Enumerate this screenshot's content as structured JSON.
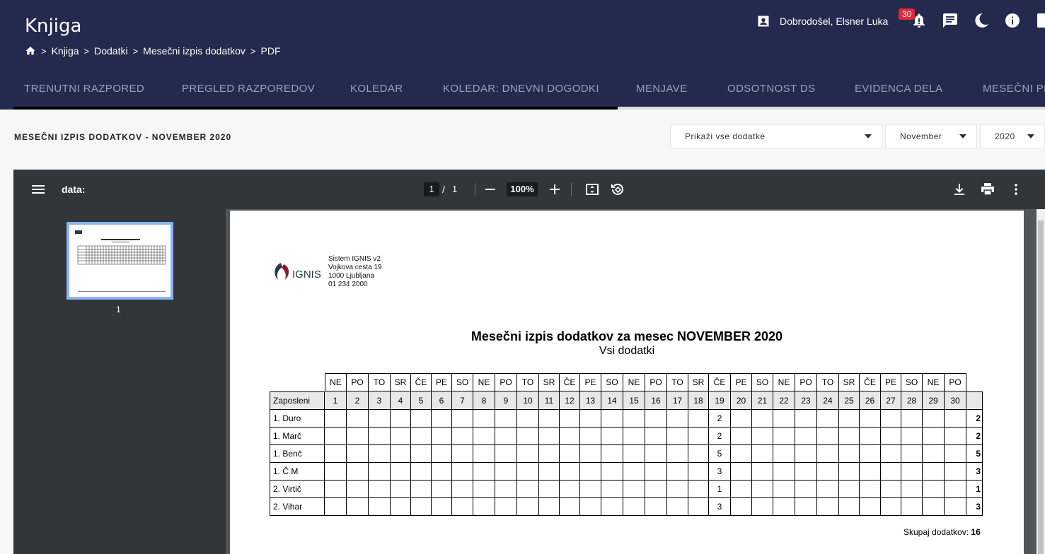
{
  "header": {
    "title": "Knjiga",
    "breadcrumb": [
      "Knjiga",
      "Dodatki",
      "Mesečni izpis dodatkov",
      "PDF"
    ],
    "user_greeting": "Dobrodošel, Elsner Luka",
    "notification_count": "30"
  },
  "tabs": [
    "TRENUTNI RAZPORED",
    "PREGLED RAZPOREDOV",
    "KOLEDAR",
    "KOLEDAR: DNEVNI DOGODKI",
    "MENJAVE",
    "ODSOTNOST DS",
    "EVIDENCA DELA",
    "MESEČNI PL"
  ],
  "page": {
    "heading": "MESEČNI IZPIS DODATKOV - NOVEMBER 2020",
    "filter_type": "Prikaži vse dodatke",
    "filter_month": "November",
    "filter_year": "2020"
  },
  "viewer": {
    "doc_name": "data:",
    "page_current": "1",
    "page_sep": "/",
    "page_total": "1",
    "zoom": "100%",
    "thumb_label": "1"
  },
  "report": {
    "company": [
      "Sistem IGNIS v2",
      "Vojkova cesta 19",
      "1000 Ljubljana",
      "01 234 2000"
    ],
    "logo_text": "IGNIS",
    "title": "Mesečni izpis dodatkov za mesec NOVEMBER 2020",
    "subtitle": "Vsi dodatki",
    "weekdays": [
      "NE",
      "PO",
      "TO",
      "SR",
      "ČE",
      "PE",
      "SO",
      "NE",
      "PO",
      "TO",
      "SR",
      "ČE",
      "PE",
      "SO",
      "NE",
      "PO",
      "TO",
      "SR",
      "ČE",
      "PE",
      "SO",
      "NE",
      "PO",
      "TO",
      "SR",
      "ČE",
      "PE",
      "SO",
      "NE",
      "PO"
    ],
    "employee_header": "Zaposleni",
    "days": [
      "1",
      "2",
      "3",
      "4",
      "5",
      "6",
      "7",
      "8",
      "9",
      "10",
      "11",
      "12",
      "13",
      "14",
      "15",
      "16",
      "17",
      "18",
      "19",
      "20",
      "21",
      "22",
      "23",
      "24",
      "25",
      "26",
      "27",
      "28",
      "29",
      "30"
    ],
    "rows": [
      {
        "name": "1. Duro",
        "day19": "2",
        "total": "2"
      },
      {
        "name": "1. Marč",
        "day19": "2",
        "total": "2"
      },
      {
        "name": "1. Benč",
        "day19": "5",
        "total": "5"
      },
      {
        "name": "1. Č M",
        "day19": "3",
        "total": "3"
      },
      {
        "name": "2. Virtič",
        "day19": "1",
        "total": "1"
      },
      {
        "name": "2. Vihar",
        "day19": "3",
        "total": "3"
      }
    ],
    "sum_label": "Skupaj dodatkov:",
    "sum_value": "16"
  },
  "colors": {
    "header_bg": "#242a4d",
    "badge": "#e0283a",
    "logo_dark": "#2c3553",
    "logo_red": "#8c1c2c"
  }
}
